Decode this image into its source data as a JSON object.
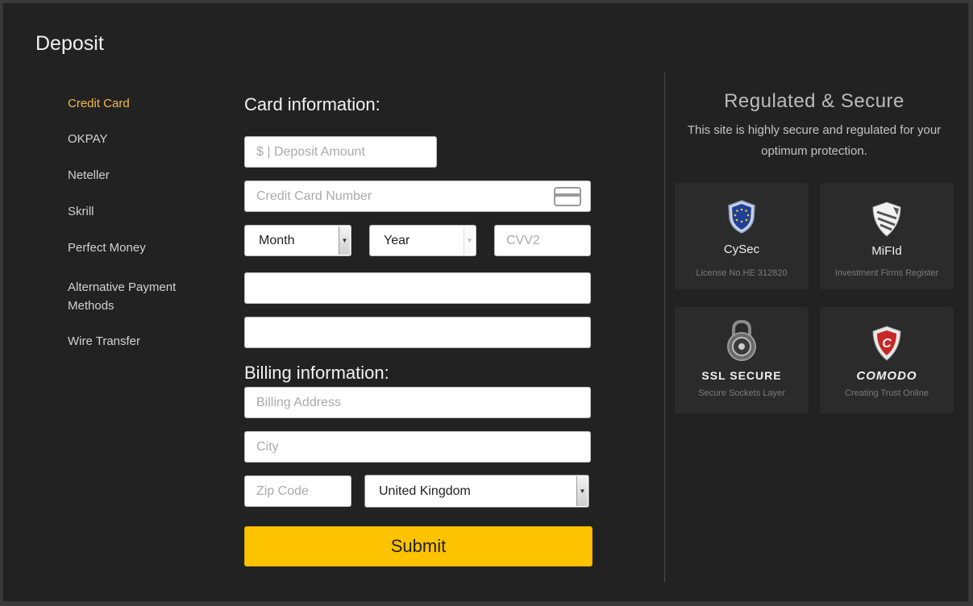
{
  "page": {
    "title": "Deposit"
  },
  "nav": {
    "items": [
      {
        "label": "Credit Card",
        "active": true
      },
      {
        "label": "OKPAY"
      },
      {
        "label": "Neteller"
      },
      {
        "label": "Skrill"
      },
      {
        "label": "Perfect Money"
      },
      {
        "label": "Alternative Payment Methods"
      },
      {
        "label": "Wire Transfer"
      }
    ]
  },
  "form": {
    "card_heading": "Card information:",
    "deposit_amount_placeholder": "$ | Deposit Amount",
    "card_number_placeholder": "Credit Card Number",
    "month_value": "Month",
    "year_value": "Year",
    "cvv_placeholder": "CVV2",
    "extra_field_1": "",
    "extra_field_2": "",
    "billing_heading": "Billing information:",
    "billing_address_placeholder": "Billing Address",
    "city_placeholder": "City",
    "zip_placeholder": "Zip Code",
    "country_value": "United Kingdom",
    "submit_label": "Submit"
  },
  "security": {
    "title": "Regulated & Secure",
    "description": "This site is highly secure and regulated for your optimum protection.",
    "badges": [
      {
        "name": "CySec",
        "sub": "License No.HE 312820",
        "icon": "eu-shield-icon"
      },
      {
        "name": "MiFId",
        "sub": "Investment Firms Register",
        "icon": "mifid-shield-icon"
      },
      {
        "name": "SSL SECURE",
        "sub": "Secure Sockets Layer",
        "icon": "padlock-icon"
      },
      {
        "name": "COMODO",
        "sub": "Creating Trust Online",
        "icon": "comodo-shield-icon"
      }
    ]
  },
  "colors": {
    "accent": "#fdc200",
    "active_nav": "#f4b94a",
    "background": "#222222"
  }
}
